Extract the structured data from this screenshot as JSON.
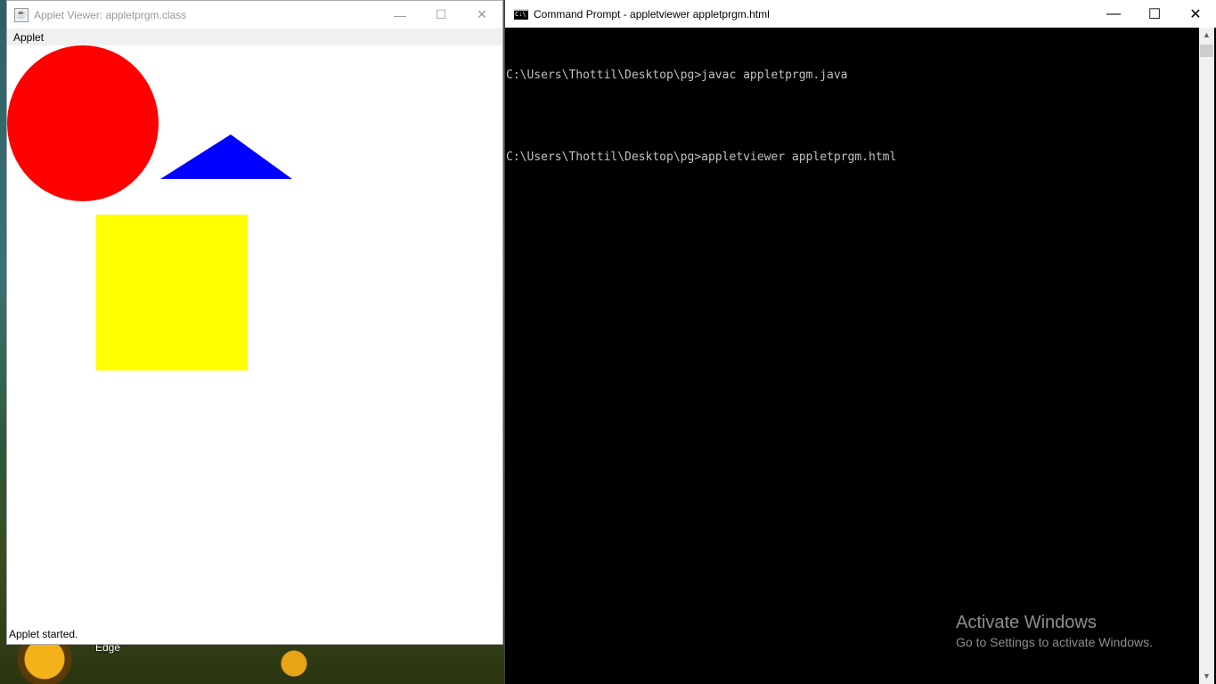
{
  "desktop": {
    "icon_label": "Edge"
  },
  "applet_viewer": {
    "title": "Applet Viewer: appletprgm.class",
    "menu": [
      "Applet"
    ],
    "status": "Applet started.",
    "shapes": {
      "circle_color": "#ff0000",
      "triangle_color": "#0000ff",
      "square_color": "#ffff00"
    }
  },
  "command_prompt": {
    "title": "Command Prompt - appletviewer  appletprgm.html",
    "lines": [
      "C:\\Users\\Thottil\\Desktop\\pg>javac appletprgm.java",
      "C:\\Users\\Thottil\\Desktop\\pg>appletviewer appletprgm.html"
    ]
  },
  "window_controls": {
    "minimize": "—",
    "maximize": "☐",
    "close": "✕"
  },
  "watermark": {
    "title": "Activate Windows",
    "subtitle": "Go to Settings to activate Windows."
  }
}
